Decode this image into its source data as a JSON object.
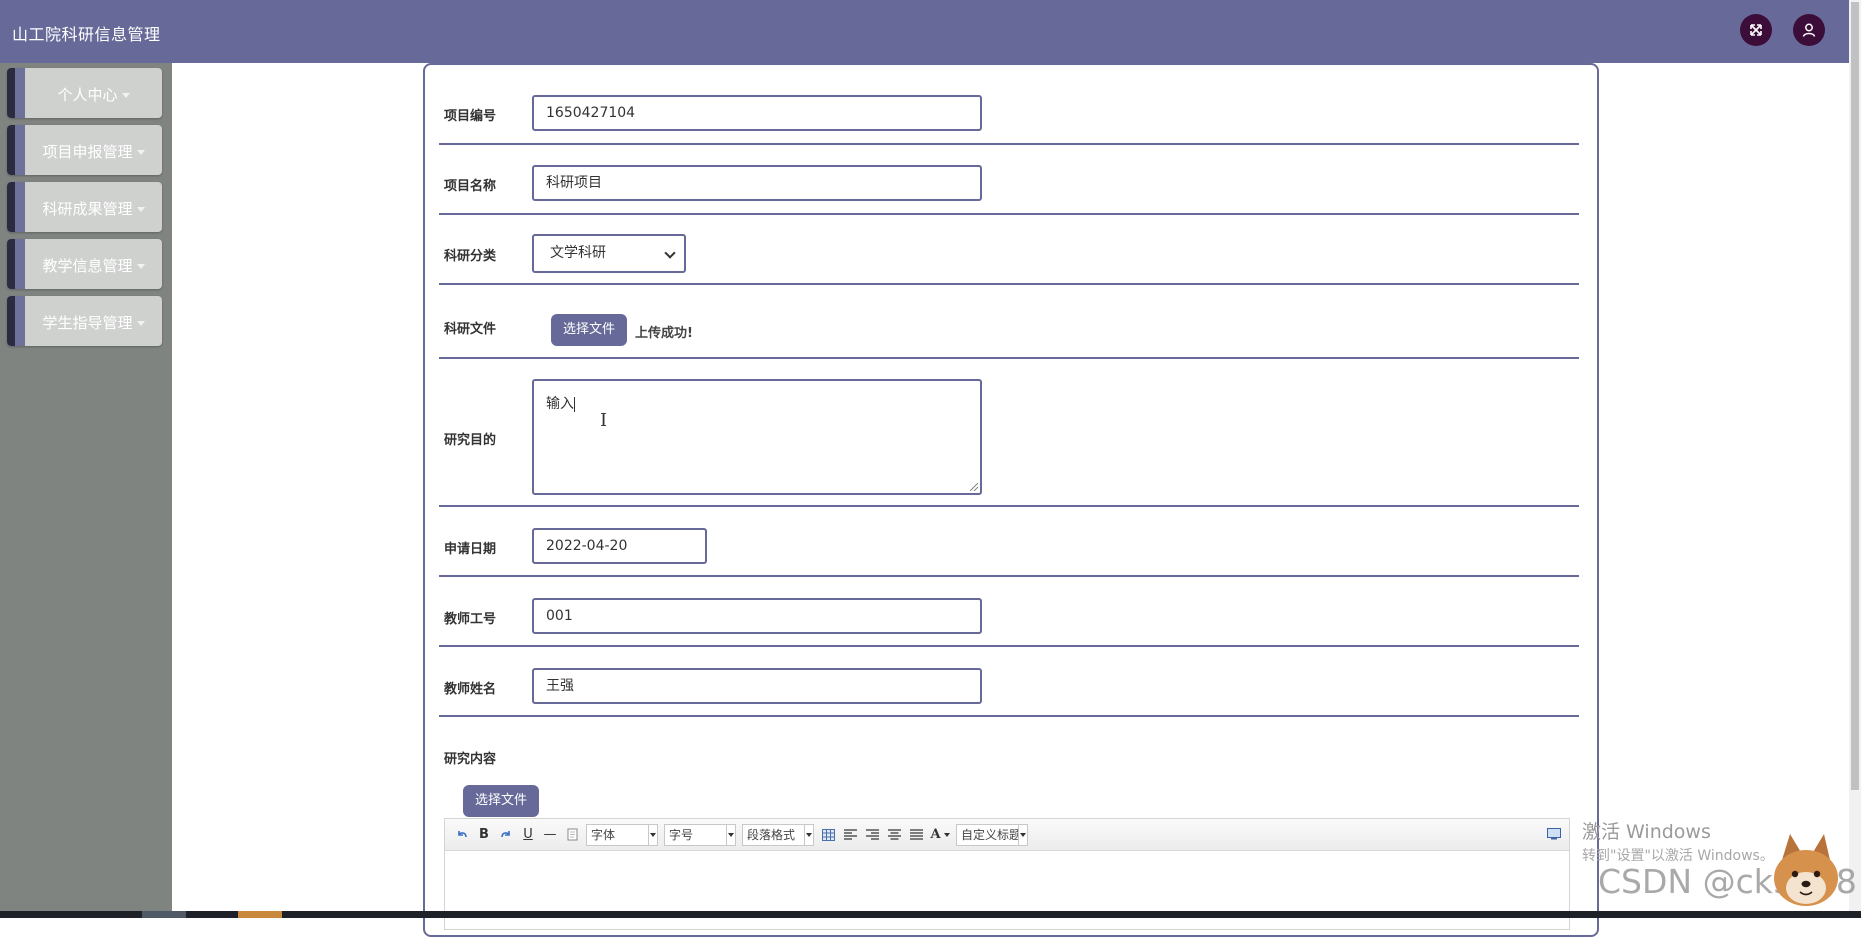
{
  "app": {
    "title": "山工院科研信息管理"
  },
  "header": {
    "fullscreen_icon": "fullscreen-icon",
    "user_icon": "user-icon"
  },
  "sidebar": {
    "items": [
      {
        "label": "个人中心"
      },
      {
        "label": "项目申报管理"
      },
      {
        "label": "科研成果管理"
      },
      {
        "label": "教学信息管理"
      },
      {
        "label": "学生指导管理"
      }
    ]
  },
  "form": {
    "project_no": {
      "label": "项目编号",
      "value": "1650427104"
    },
    "project_name": {
      "label": "项目名称",
      "value": "科研项目"
    },
    "category": {
      "label": "科研分类",
      "value": "文学科研"
    },
    "file": {
      "label": "科研文件",
      "button": "选择文件",
      "status": "上传成功!"
    },
    "purpose": {
      "label": "研究目的",
      "value": "输入"
    },
    "apply_date": {
      "label": "申请日期",
      "value": "2022-04-20"
    },
    "teacher_id": {
      "label": "教师工号",
      "value": "001"
    },
    "teacher_name": {
      "label": "教师姓名",
      "value": "王强"
    },
    "content": {
      "label": "研究内容",
      "button": "选择文件"
    }
  },
  "editor": {
    "toolbar": {
      "undo_icon": "undo-icon",
      "bold": "B",
      "redo_icon": "redo-icon",
      "underline": "U",
      "hr": "—",
      "font_family": "字体",
      "font_size": "字号",
      "paragraph": "段落格式",
      "font_color": "A",
      "custom_title": "自定义标题"
    }
  },
  "watermarks": {
    "activate_windows": "激活 Windows",
    "activate_hint": "转到\"设置\"以激活 Windows。",
    "csdn": "CSDN @ck3018"
  },
  "colors": {
    "accent": "#676a99",
    "sidebar_bg": "#808481",
    "menu_bg": "#cfd1cf",
    "icon_bg": "#3d0d3a"
  }
}
